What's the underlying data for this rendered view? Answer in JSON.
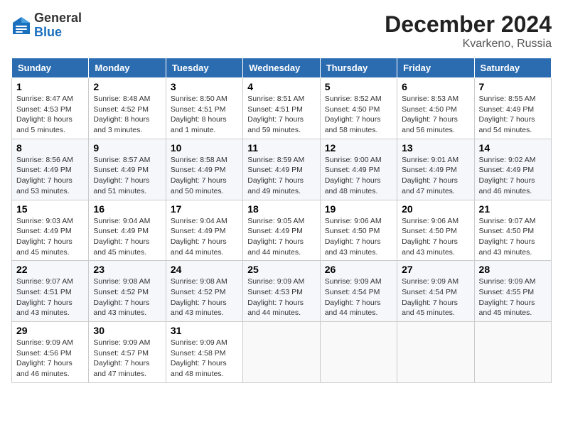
{
  "header": {
    "logo": {
      "general": "General",
      "blue": "Blue"
    },
    "title": "December 2024",
    "location": "Kvarkeno, Russia"
  },
  "weekdays": [
    "Sunday",
    "Monday",
    "Tuesday",
    "Wednesday",
    "Thursday",
    "Friday",
    "Saturday"
  ],
  "weeks": [
    [
      {
        "day": "1",
        "sunrise": "Sunrise: 8:47 AM",
        "sunset": "Sunset: 4:53 PM",
        "daylight": "Daylight: 8 hours and 5 minutes."
      },
      {
        "day": "2",
        "sunrise": "Sunrise: 8:48 AM",
        "sunset": "Sunset: 4:52 PM",
        "daylight": "Daylight: 8 hours and 3 minutes."
      },
      {
        "day": "3",
        "sunrise": "Sunrise: 8:50 AM",
        "sunset": "Sunset: 4:51 PM",
        "daylight": "Daylight: 8 hours and 1 minute."
      },
      {
        "day": "4",
        "sunrise": "Sunrise: 8:51 AM",
        "sunset": "Sunset: 4:51 PM",
        "daylight": "Daylight: 7 hours and 59 minutes."
      },
      {
        "day": "5",
        "sunrise": "Sunrise: 8:52 AM",
        "sunset": "Sunset: 4:50 PM",
        "daylight": "Daylight: 7 hours and 58 minutes."
      },
      {
        "day": "6",
        "sunrise": "Sunrise: 8:53 AM",
        "sunset": "Sunset: 4:50 PM",
        "daylight": "Daylight: 7 hours and 56 minutes."
      },
      {
        "day": "7",
        "sunrise": "Sunrise: 8:55 AM",
        "sunset": "Sunset: 4:49 PM",
        "daylight": "Daylight: 7 hours and 54 minutes."
      }
    ],
    [
      {
        "day": "8",
        "sunrise": "Sunrise: 8:56 AM",
        "sunset": "Sunset: 4:49 PM",
        "daylight": "Daylight: 7 hours and 53 minutes."
      },
      {
        "day": "9",
        "sunrise": "Sunrise: 8:57 AM",
        "sunset": "Sunset: 4:49 PM",
        "daylight": "Daylight: 7 hours and 51 minutes."
      },
      {
        "day": "10",
        "sunrise": "Sunrise: 8:58 AM",
        "sunset": "Sunset: 4:49 PM",
        "daylight": "Daylight: 7 hours and 50 minutes."
      },
      {
        "day": "11",
        "sunrise": "Sunrise: 8:59 AM",
        "sunset": "Sunset: 4:49 PM",
        "daylight": "Daylight: 7 hours and 49 minutes."
      },
      {
        "day": "12",
        "sunrise": "Sunrise: 9:00 AM",
        "sunset": "Sunset: 4:49 PM",
        "daylight": "Daylight: 7 hours and 48 minutes."
      },
      {
        "day": "13",
        "sunrise": "Sunrise: 9:01 AM",
        "sunset": "Sunset: 4:49 PM",
        "daylight": "Daylight: 7 hours and 47 minutes."
      },
      {
        "day": "14",
        "sunrise": "Sunrise: 9:02 AM",
        "sunset": "Sunset: 4:49 PM",
        "daylight": "Daylight: 7 hours and 46 minutes."
      }
    ],
    [
      {
        "day": "15",
        "sunrise": "Sunrise: 9:03 AM",
        "sunset": "Sunset: 4:49 PM",
        "daylight": "Daylight: 7 hours and 45 minutes."
      },
      {
        "day": "16",
        "sunrise": "Sunrise: 9:04 AM",
        "sunset": "Sunset: 4:49 PM",
        "daylight": "Daylight: 7 hours and 45 minutes."
      },
      {
        "day": "17",
        "sunrise": "Sunrise: 9:04 AM",
        "sunset": "Sunset: 4:49 PM",
        "daylight": "Daylight: 7 hours and 44 minutes."
      },
      {
        "day": "18",
        "sunrise": "Sunrise: 9:05 AM",
        "sunset": "Sunset: 4:49 PM",
        "daylight": "Daylight: 7 hours and 44 minutes."
      },
      {
        "day": "19",
        "sunrise": "Sunrise: 9:06 AM",
        "sunset": "Sunset: 4:50 PM",
        "daylight": "Daylight: 7 hours and 43 minutes."
      },
      {
        "day": "20",
        "sunrise": "Sunrise: 9:06 AM",
        "sunset": "Sunset: 4:50 PM",
        "daylight": "Daylight: 7 hours and 43 minutes."
      },
      {
        "day": "21",
        "sunrise": "Sunrise: 9:07 AM",
        "sunset": "Sunset: 4:50 PM",
        "daylight": "Daylight: 7 hours and 43 minutes."
      }
    ],
    [
      {
        "day": "22",
        "sunrise": "Sunrise: 9:07 AM",
        "sunset": "Sunset: 4:51 PM",
        "daylight": "Daylight: 7 hours and 43 minutes."
      },
      {
        "day": "23",
        "sunrise": "Sunrise: 9:08 AM",
        "sunset": "Sunset: 4:52 PM",
        "daylight": "Daylight: 7 hours and 43 minutes."
      },
      {
        "day": "24",
        "sunrise": "Sunrise: 9:08 AM",
        "sunset": "Sunset: 4:52 PM",
        "daylight": "Daylight: 7 hours and 43 minutes."
      },
      {
        "day": "25",
        "sunrise": "Sunrise: 9:09 AM",
        "sunset": "Sunset: 4:53 PM",
        "daylight": "Daylight: 7 hours and 44 minutes."
      },
      {
        "day": "26",
        "sunrise": "Sunrise: 9:09 AM",
        "sunset": "Sunset: 4:54 PM",
        "daylight": "Daylight: 7 hours and 44 minutes."
      },
      {
        "day": "27",
        "sunrise": "Sunrise: 9:09 AM",
        "sunset": "Sunset: 4:54 PM",
        "daylight": "Daylight: 7 hours and 45 minutes."
      },
      {
        "day": "28",
        "sunrise": "Sunrise: 9:09 AM",
        "sunset": "Sunset: 4:55 PM",
        "daylight": "Daylight: 7 hours and 45 minutes."
      }
    ],
    [
      {
        "day": "29",
        "sunrise": "Sunrise: 9:09 AM",
        "sunset": "Sunset: 4:56 PM",
        "daylight": "Daylight: 7 hours and 46 minutes."
      },
      {
        "day": "30",
        "sunrise": "Sunrise: 9:09 AM",
        "sunset": "Sunset: 4:57 PM",
        "daylight": "Daylight: 7 hours and 47 minutes."
      },
      {
        "day": "31",
        "sunrise": "Sunrise: 9:09 AM",
        "sunset": "Sunset: 4:58 PM",
        "daylight": "Daylight: 7 hours and 48 minutes."
      },
      null,
      null,
      null,
      null
    ]
  ]
}
